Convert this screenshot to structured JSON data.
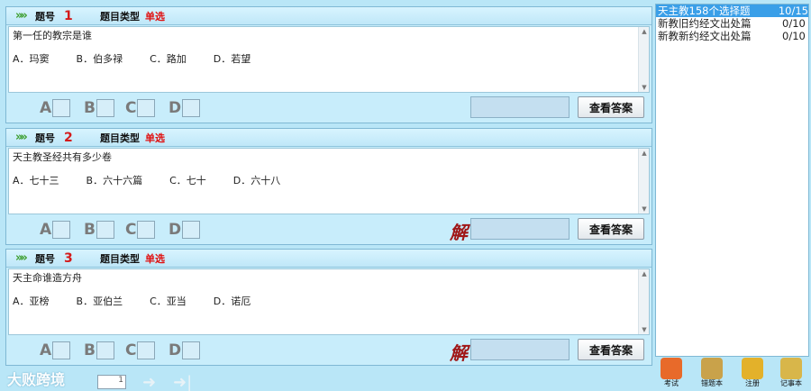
{
  "questions": [
    {
      "number_label": "题号",
      "number": "1",
      "type_label": "题目类型",
      "type": "单选",
      "text": "第一任的教宗是谁",
      "options": [
        "A．玛窦",
        "B．伯多禄",
        "C．路加",
        "D．若望"
      ],
      "show_jie": false
    },
    {
      "number_label": "题号",
      "number": "2",
      "type_label": "题目类型",
      "type": "单选",
      "text": "天主教圣经共有多少卷",
      "options": [
        "A．七十三",
        "B．六十六篇",
        "C．七十",
        "D．六十八"
      ],
      "show_jie": true
    },
    {
      "number_label": "题号",
      "number": "3",
      "type_label": "题目类型",
      "type": "单选",
      "text": "天主命谁造方舟",
      "options": [
        "A．亚榜",
        "B．亚伯兰",
        "C．亚当",
        "D．诺厄"
      ],
      "show_jie": true
    }
  ],
  "answer_letters": [
    "A",
    "B",
    "C",
    "D"
  ],
  "view_answer_label": "查看答案",
  "jie_label": "解",
  "sidebar": {
    "items": [
      {
        "name": "天主教158个选择题",
        "count": "10/15",
        "selected": true
      },
      {
        "name": "新教旧约经文出处篇",
        "count": "0/10",
        "selected": false
      },
      {
        "name": "新教新约经文出处篇",
        "count": "0/10",
        "selected": false
      }
    ]
  },
  "toolbar": {
    "items": [
      {
        "label": "考试",
        "icon": "lifebuoy-icon",
        "color": "#e86a2a"
      },
      {
        "label": "错题本",
        "icon": "notebook-icon",
        "color": "#c9a24a"
      },
      {
        "label": "注册",
        "icon": "key-icon",
        "color": "#e3b12a"
      },
      {
        "label": "记事本",
        "icon": "notepad-pencil-icon",
        "color": "#d8b64a"
      }
    ]
  },
  "footer": {
    "watermark": "大败跨境",
    "page_value": "1"
  }
}
